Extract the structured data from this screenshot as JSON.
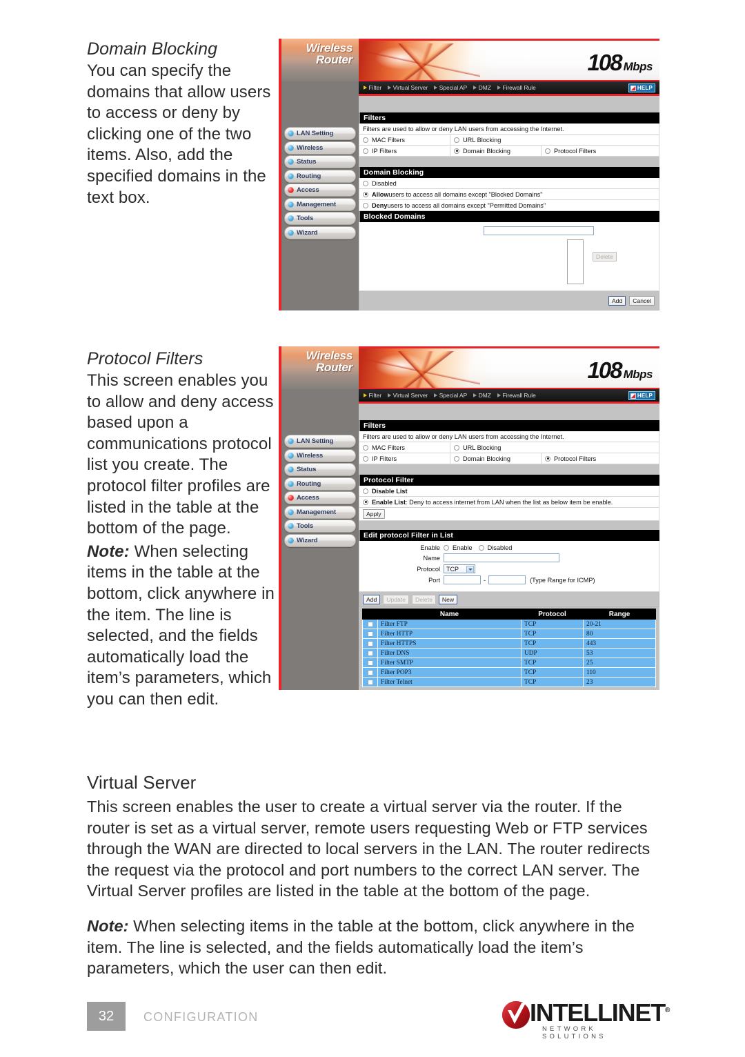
{
  "page": {
    "number": "32",
    "section_label": "CONFIGURATION",
    "brand": {
      "name": "INTELLINET",
      "tagline": "NETWORK SOLUTIONS",
      "tm": "®"
    }
  },
  "sections": [
    {
      "heading": "Domain Blocking",
      "body": "You can specify the domains that allow users to access or deny by clicking one of the two items. Also, add the specified domains in the text box."
    },
    {
      "heading": "Protocol Filters",
      "body": "This screen enables you to allow and deny access based upon a communications protocol list you create. The protocol filter profiles are listed in the table at the bottom of the page.",
      "note_lead": "Note:",
      "note_body": " When selecting items in the table at the bottom, click anywhere in the item. The line is selected, and the fields automatically load the item’s parameters, which you can then edit."
    }
  ],
  "virtual_server": {
    "heading": "Virtual Server",
    "body": "This screen enables the user to create a virtual server via the router. If the router is set as a virtual server, remote users requesting Web or FTP services through the WAN are directed to local servers in the LAN. The router redirects the request via the protocol and port numbers to the correct LAN server. The Virtual Server profiles are listed in the table at the bottom of the page.",
    "note_lead": "Note:",
    "note_body": " When selecting items in the table at the bottom, click anywhere in the item. The line is selected, and the fields automatically load the item’s parameters, which the user can then edit."
  },
  "router_ui": {
    "brand_line1": "Wireless",
    "brand_line2": "Router",
    "speed_number": "108",
    "speed_unit": "Mbps",
    "help_label": "HELP",
    "topnav": [
      {
        "label": "Filter",
        "active": true
      },
      {
        "label": "Virtual Server",
        "active": false
      },
      {
        "label": "Special AP",
        "active": false
      },
      {
        "label": "DMZ",
        "active": false
      },
      {
        "label": "Firewall Rule",
        "active": false
      }
    ],
    "sidebar": [
      {
        "label": "LAN Setting",
        "state": "normal"
      },
      {
        "label": "Wireless",
        "state": "normal"
      },
      {
        "label": "Status",
        "state": "normal"
      },
      {
        "label": "Routing",
        "state": "normal"
      },
      {
        "label": "Access",
        "state": "selected"
      },
      {
        "label": "Management",
        "state": "normal"
      },
      {
        "label": "Tools",
        "state": "normal"
      },
      {
        "label": "Wizard",
        "state": "normal"
      }
    ],
    "filters_title": "Filters",
    "filters_desc": "Filters are used to allow or deny LAN users from accessing the Internet.",
    "filter_options_row1": [
      {
        "label": "MAC Filters",
        "selected": false
      },
      {
        "label": "URL Blocking",
        "selected": false
      }
    ],
    "filter_options_row2_domain": [
      {
        "label": "IP Filters",
        "selected": false
      },
      {
        "label": "Domain Blocking",
        "selected": true
      },
      {
        "label": "Protocol Filters",
        "selected": false
      }
    ],
    "filter_options_row2_protocol": [
      {
        "label": "IP Filters",
        "selected": false
      },
      {
        "label": "Domain Blocking",
        "selected": false
      },
      {
        "label": "Protocol Filters",
        "selected": true
      }
    ]
  },
  "screen_domain_blocking": {
    "panel_title": "Domain Blocking",
    "modes": [
      {
        "label": "Disabled",
        "selected": false,
        "bold_prefix": ""
      },
      {
        "label": " users to access all domains except \"Blocked Domains\"",
        "selected": true,
        "bold_prefix": "Allow"
      },
      {
        "label": " users to access all domains except \"Permitted Domains\"",
        "selected": false,
        "bold_prefix": "Deny"
      }
    ],
    "blocked_title": "Blocked Domains",
    "domain_input_value": "",
    "delete_label": "Delete",
    "add_label": "Add",
    "cancel_label": "Cancel"
  },
  "screen_protocol_filters": {
    "panel_title": "Protocol Filter",
    "disable_option": {
      "label": "Disable List",
      "selected": false
    },
    "enable_option": {
      "bold_prefix": "Enable List",
      "label": " : Deny to access internet from LAN when the list as below item be enable.",
      "selected": true
    },
    "apply_label": "Apply",
    "edit_title": "Edit protocol Filter in List",
    "form": {
      "enable_label": "Enable",
      "enable_radio_label": "Enable",
      "disabled_radio_label": "Disabled",
      "name_label": "Name",
      "name_value": "",
      "protocol_label": "Protocol",
      "protocol_value": "TCP",
      "port_label": "Port",
      "port_from": "",
      "port_to": "",
      "port_sep": "-",
      "port_hint": "(Type Range for ICMP)"
    },
    "buttons": [
      {
        "label": "Add",
        "disabled": false,
        "primary": false
      },
      {
        "label": "Update",
        "disabled": true,
        "primary": false
      },
      {
        "label": "Delete",
        "disabled": true,
        "primary": false
      },
      {
        "label": "New",
        "disabled": false,
        "primary": true
      }
    ],
    "table": {
      "columns": [
        "",
        "Name",
        "Protocol",
        "Range"
      ],
      "rows": [
        {
          "checked": false,
          "name": "Filter FTP",
          "protocol": "TCP",
          "range": "20-21"
        },
        {
          "checked": false,
          "name": "Filter HTTP",
          "protocol": "TCP",
          "range": "80"
        },
        {
          "checked": false,
          "name": "Filter HTTPS",
          "protocol": "TCP",
          "range": "443"
        },
        {
          "checked": false,
          "name": "Filter DNS",
          "protocol": "UDP",
          "range": "53"
        },
        {
          "checked": false,
          "name": "Filter SMTP",
          "protocol": "TCP",
          "range": "25"
        },
        {
          "checked": false,
          "name": "Filter POP3",
          "protocol": "TCP",
          "range": "110"
        },
        {
          "checked": false,
          "name": "Filter Telnet",
          "protocol": "TCP",
          "range": "23"
        }
      ]
    }
  },
  "colors": {
    "accent_red": "#e8232a",
    "table_row": "#6cb7f0",
    "nav_label": "#2d3e63",
    "page_box": "#9d9d9d"
  }
}
